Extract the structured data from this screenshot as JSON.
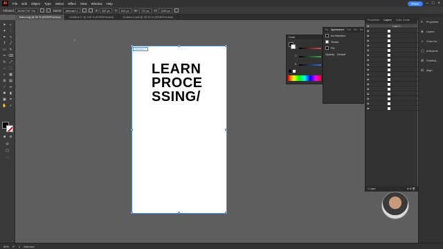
{
  "menubar": {
    "app_icon": "Ai",
    "items": [
      "File",
      "Edit",
      "Object",
      "Type",
      "Select",
      "Effect",
      "View",
      "Window",
      "Help"
    ],
    "share_label": "Share"
  },
  "controlbar": {
    "selection": "Artboard",
    "preset": "MONITOR TAL",
    "name_label": "Name:",
    "name_value": "Artboard 1",
    "x_label": "X:",
    "x_value": "360 px",
    "y_label": "Y:",
    "y_value": "640 px",
    "w_label": "W:",
    "w_value": "720 px",
    "h_label": "H:",
    "h_value": "1280 px"
  },
  "tabs": [
    "learn.svg @ 50 % (RGB/Preview)",
    "Untitled-1* @ 100 % (RGB/Preview)",
    "Untitled-3.pdf @ 33.33 % (RGB/Preview)"
  ],
  "artboard": {
    "label": "Artboard 1",
    "lines": [
      "LEARN",
      "PROCE",
      "SSING/"
    ]
  },
  "color_panel": {
    "title": "Color",
    "labels": [
      "R",
      "G",
      "B"
    ],
    "accent_colors": [
      "#e24b4b",
      "#3fae4a",
      "#3b6fd8"
    ]
  },
  "appearance_panel": {
    "tabs": [
      "Tra",
      "Appearance",
      "Gra",
      "Sw",
      "Bru"
    ],
    "rows": [
      {
        "label": "No Selection",
        "chip": "#000000"
      },
      {
        "label": "Stroke:",
        "chip": "#ffffff"
      },
      {
        "label": "Fill:",
        "chip": "#000000"
      },
      {
        "label": "Opacity:",
        "value": "Default"
      }
    ]
  },
  "layers_panel": {
    "tabs": [
      "Properties",
      "Layers",
      "Color Guide"
    ],
    "top_layer": "Layer 1",
    "count_label": "1 Layer"
  },
  "right_dock": {
    "items": [
      {
        "glyph": "≡",
        "label": "Properties"
      },
      {
        "glyph": "◈",
        "label": "Layers"
      },
      {
        "glyph": "◑",
        "label": "Color Gu..."
      },
      {
        "glyph": "▢",
        "label": "Artboards"
      },
      {
        "glyph": "⊞",
        "label": "Pathfind..."
      },
      {
        "glyph": "⊟",
        "label": "Align"
      }
    ]
  },
  "statusbar": {
    "zoom": "50%",
    "angle": "0°",
    "artboard_nav": "1",
    "tool": "Artboard"
  }
}
